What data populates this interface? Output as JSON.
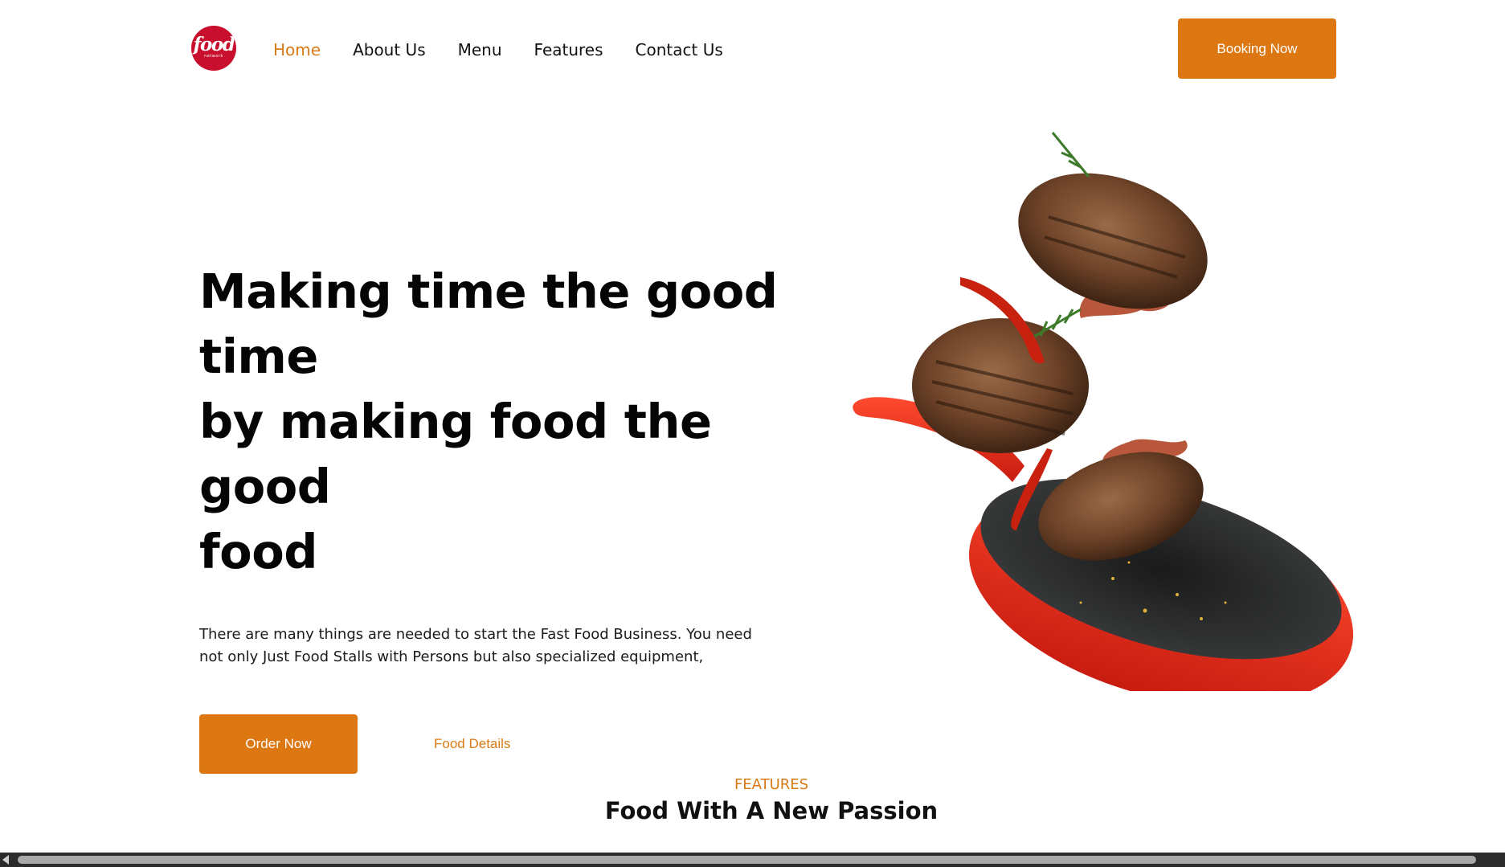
{
  "brand": {
    "logo_word": "food",
    "logo_sub": "network",
    "color": "#c8102e"
  },
  "nav": {
    "items": [
      {
        "label": "Home",
        "active": true
      },
      {
        "label": "About Us"
      },
      {
        "label": "Menu"
      },
      {
        "label": "Features"
      },
      {
        "label": "Contact Us"
      }
    ]
  },
  "header": {
    "booking_label": "Booking Now"
  },
  "hero": {
    "title_lines": [
      "Making time the good",
      "time",
      "by making food the",
      "good",
      "food"
    ],
    "description_lines": [
      "There are many things are needed to start the Fast Food Business. You need",
      "not only Just Food Stalls with Persons but also specialized equipment,"
    ],
    "order_label": "Order Now",
    "details_label": "Food Details",
    "image_icon": "flying-burger-patties-frying-pan-image"
  },
  "features": {
    "label": "FEATURES",
    "title": "Food With A New Passion"
  },
  "colors": {
    "accent": "#dd7712",
    "text": "#111111",
    "pan": "#e8321f"
  }
}
